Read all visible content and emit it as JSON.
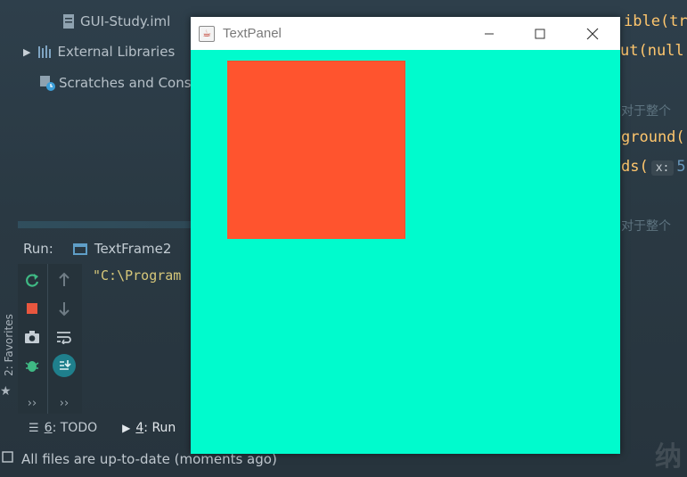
{
  "project_tree": {
    "items": [
      {
        "label": "GUI-Study.iml",
        "icon": "module-file-icon"
      },
      {
        "label": "External Libraries",
        "icon": "library-icon"
      },
      {
        "label": "Scratches and Conso",
        "icon": "scratches-icon"
      }
    ]
  },
  "code": {
    "line1": "ible(tru",
    "line2": "ut(null",
    "comment1": "对于整个",
    "line3": "ground(",
    "line4_pre": "ds(",
    "line4_hint": "x:",
    "line4_post": "5",
    "comment2": "对于整个"
  },
  "run_panel": {
    "title": "Run:",
    "tab_label": "TextFrame2",
    "console_output": "\"C:\\Program"
  },
  "favorites_label": "2: Favorites",
  "bottom_tabs": [
    {
      "num": "6",
      "label": ": TODO"
    },
    {
      "num": "4",
      "label": ": Run"
    }
  ],
  "status": {
    "text": "All files are up-to-date (moments ago)"
  },
  "watermark": "纳",
  "java_window": {
    "title": "TextPanel",
    "background_color": "#00fbcd",
    "panel_color": "#ff542e"
  },
  "colors": {
    "ide_background": "#2b3a44",
    "console_text": "#d6c77a",
    "rerun_green": "#3fb984",
    "stop_red": "#e9573f"
  }
}
